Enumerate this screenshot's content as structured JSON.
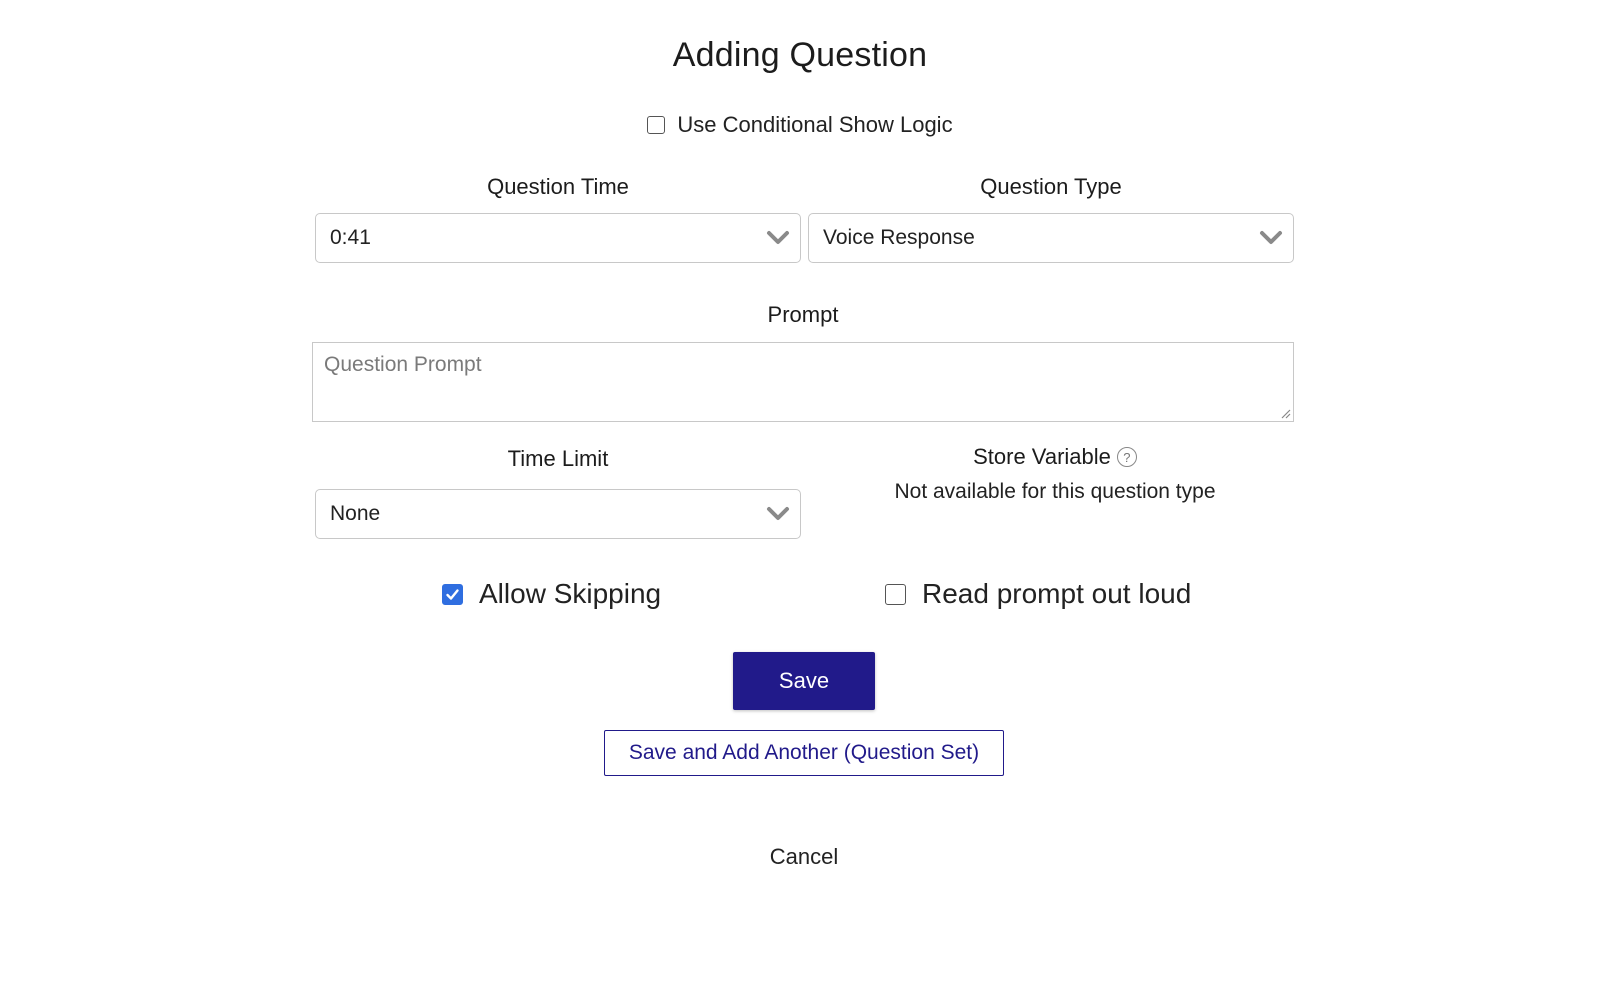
{
  "dialog": {
    "title": "Adding Question"
  },
  "conditional": {
    "label": "Use Conditional Show Logic",
    "checked": false
  },
  "question_time": {
    "label": "Question Time",
    "value": "0:41"
  },
  "question_type": {
    "label": "Question Type",
    "value": "Voice Response"
  },
  "prompt": {
    "label": "Prompt",
    "placeholder": "Question Prompt",
    "value": ""
  },
  "time_limit": {
    "label": "Time Limit",
    "value": "None"
  },
  "store_variable": {
    "label": "Store Variable",
    "help_icon": "question-circle-icon",
    "note": "Not available for this question type"
  },
  "allow_skipping": {
    "label": "Allow Skipping",
    "checked": true
  },
  "read_aloud": {
    "label": "Read prompt out loud",
    "checked": false
  },
  "actions": {
    "save_label": "Save",
    "save_another_label": "Save and Add Another (Question Set)",
    "cancel_label": "Cancel"
  },
  "colors": {
    "primary": "#211a8a",
    "checkbox_checked": "#2f6ee0",
    "border": "#c8c8c8"
  }
}
